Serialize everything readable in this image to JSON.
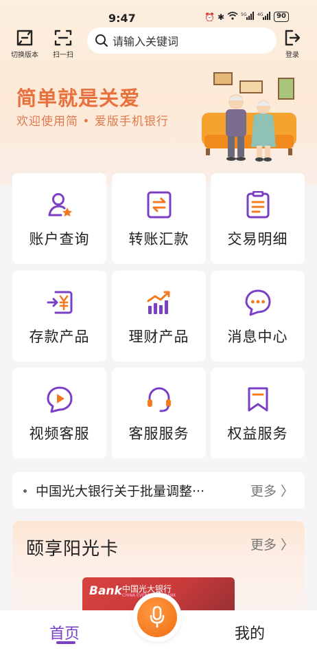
{
  "status_bar": {
    "time": "9:47",
    "battery": "90"
  },
  "header": {
    "switch_label": "切换版本",
    "scan_label": "扫一扫",
    "search_placeholder": "请输入关键词",
    "login_label": "登录"
  },
  "hero": {
    "title": "简单就是关爱",
    "subtitle": "欢迎使用简 • 爱版手机银行"
  },
  "grid": [
    {
      "label": "账户查询",
      "icon": "account-query-icon"
    },
    {
      "label": "转账汇款",
      "icon": "transfer-icon"
    },
    {
      "label": "交易明细",
      "icon": "transaction-detail-icon"
    },
    {
      "label": "存款产品",
      "icon": "deposit-icon"
    },
    {
      "label": "理财产品",
      "icon": "wealth-chart-icon"
    },
    {
      "label": "消息中心",
      "icon": "message-bubble-icon"
    },
    {
      "label": "视频客服",
      "icon": "video-play-icon"
    },
    {
      "label": "客服服务",
      "icon": "headset-icon"
    },
    {
      "label": "权益服务",
      "icon": "bookmark-icon"
    }
  ],
  "notice": {
    "text": "中国光大银行关于批量调整···",
    "more": "更多 〉"
  },
  "card_section": {
    "title": "颐享阳光卡",
    "more": "更多 〉",
    "card_logo": "Bank",
    "card_name": "中国光大银行",
    "card_sub": "CHINA EVERBRIGHT BANK"
  },
  "bottom_nav": {
    "home": "首页",
    "mine": "我的"
  },
  "colors": {
    "accent_purple": "#7a3fc4",
    "accent_orange": "#f47a1f",
    "hero_text": "#e8703c"
  }
}
